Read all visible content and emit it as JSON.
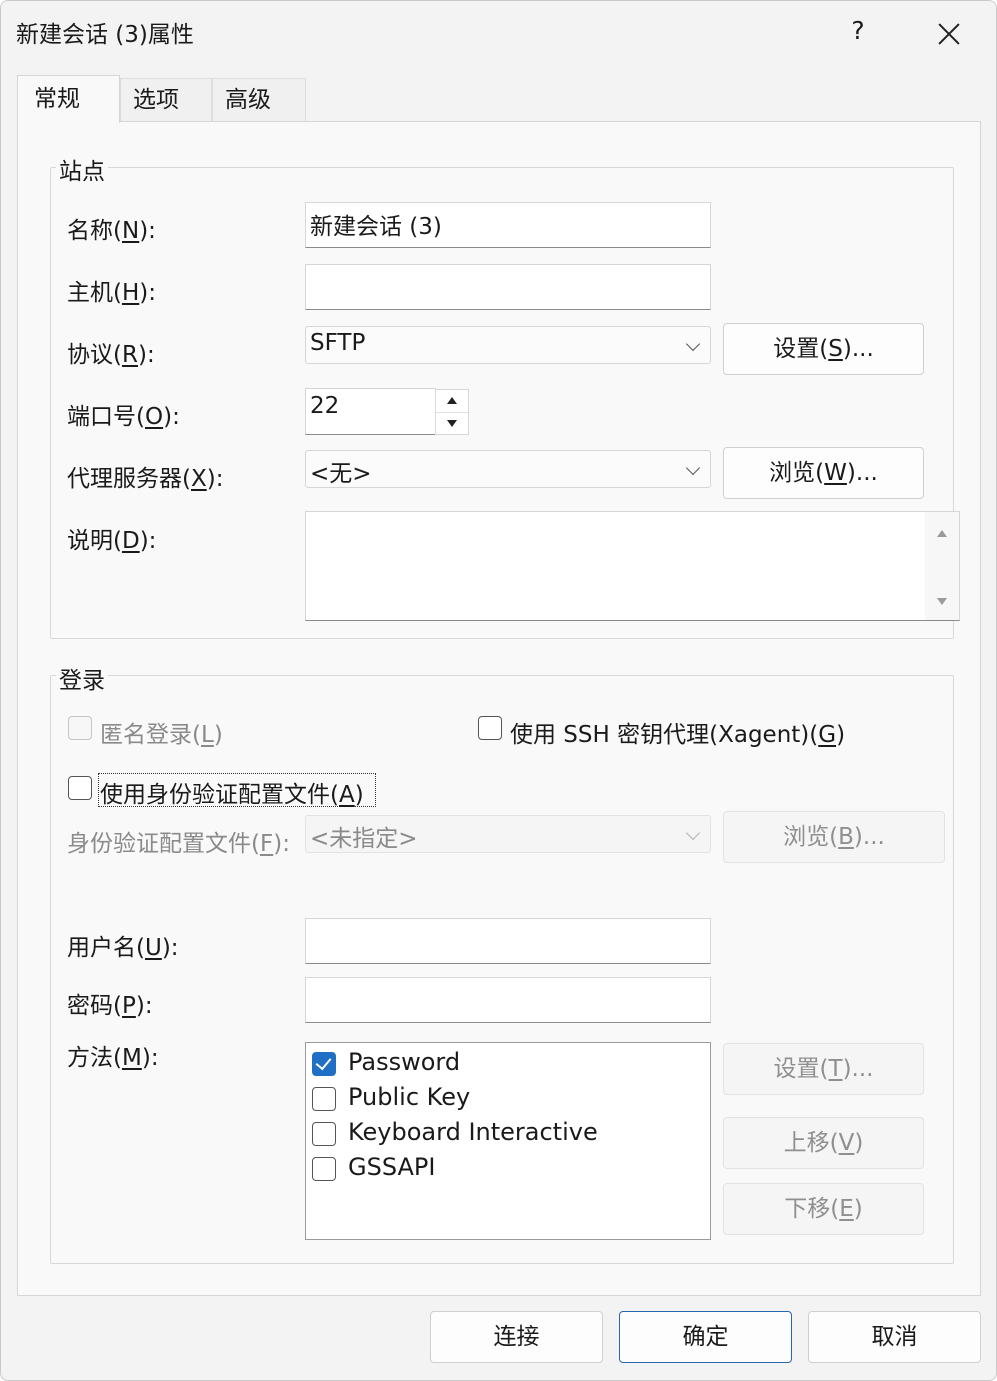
{
  "window": {
    "title": "新建会话 (3)属性",
    "help_label": "?",
    "close_label": "close"
  },
  "tabs": [
    {
      "label": "常规",
      "active": true
    },
    {
      "label": "选项",
      "active": false
    },
    {
      "label": "高级",
      "active": false
    }
  ],
  "site": {
    "group_label": "站点",
    "name_label": "名称(N):",
    "name_value": "新建会话 (3)",
    "host_label": "主机(H):",
    "host_value": "",
    "protocol_label": "协议(R):",
    "protocol_value": "SFTP",
    "protocol_settings_button": "设置(S)...",
    "port_label": "端口号(O):",
    "port_value": "22",
    "proxy_label": "代理服务器(X):",
    "proxy_value": "<无>",
    "proxy_browse_button": "浏览(W)...",
    "description_label": "说明(D):",
    "description_value": ""
  },
  "login": {
    "group_label": "登录",
    "anonymous_label": "匿名登录(L)",
    "anonymous_checked": false,
    "anonymous_enabled": false,
    "ssh_agent_label": "使用 SSH 密钥代理(Xagent)(G)",
    "ssh_agent_checked": false,
    "auth_profile_checkbox_label": "使用身份验证配置文件(A)",
    "auth_profile_checked": false,
    "auth_profile_label": "身份验证配置文件(F):",
    "auth_profile_value": "<未指定>",
    "auth_profile_browse_button": "浏览(B)...",
    "username_label": "用户名(U):",
    "username_value": "",
    "password_label": "密码(P):",
    "password_value": "",
    "method_label": "方法(M):",
    "methods": [
      {
        "label": "Password",
        "checked": true
      },
      {
        "label": "Public Key",
        "checked": false
      },
      {
        "label": "Keyboard Interactive",
        "checked": false
      },
      {
        "label": "GSSAPI",
        "checked": false
      }
    ],
    "method_settings_button": "设置(T)...",
    "move_up_button": "上移(V)",
    "move_down_button": "下移(E)"
  },
  "footer": {
    "connect_button": "连接",
    "ok_button": "确定",
    "cancel_button": "取消"
  },
  "colors": {
    "accent": "#1f6fc5",
    "window_bg": "#f3f3f3",
    "panel_bg": "#f9f9f9",
    "disabled_text": "#8a8a8a"
  }
}
